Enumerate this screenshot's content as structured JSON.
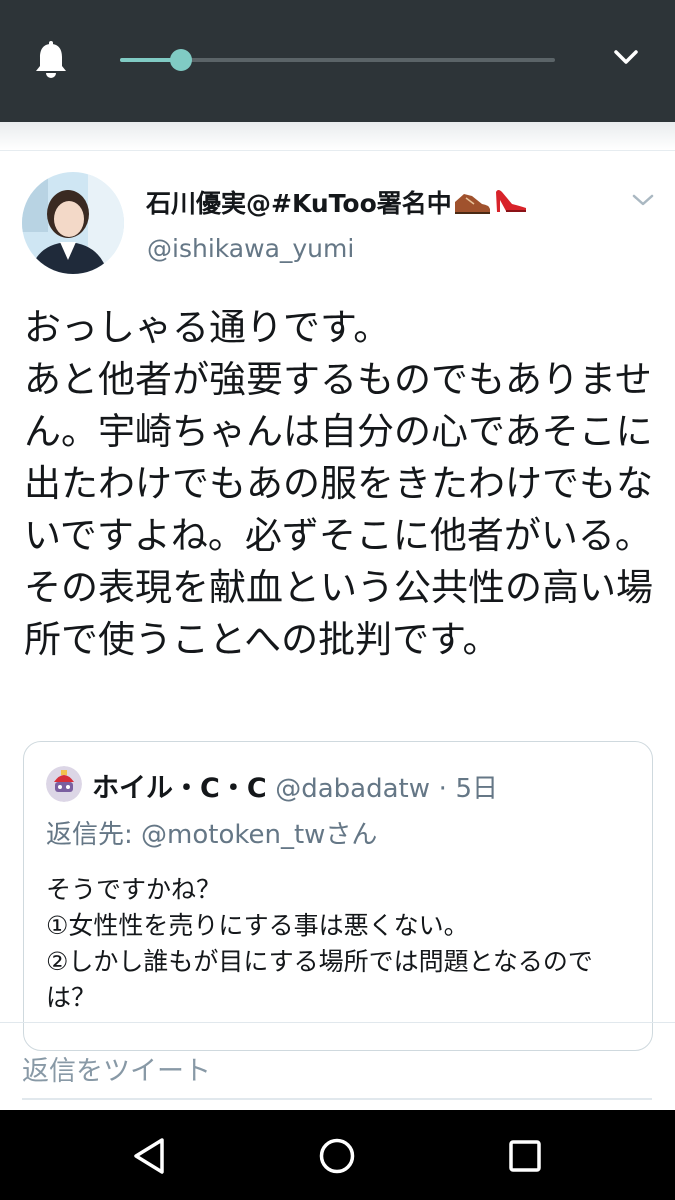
{
  "notification_shade": {
    "brightness_level": 0.14,
    "icons": {
      "bell": "bell-icon",
      "expand": "chevron-down-icon"
    },
    "colors": {
      "background": "#2d3438",
      "accent": "#80cbc4"
    }
  },
  "tweet": {
    "display_name": "石川優実@#KuToo署名中",
    "name_emojis": [
      "man's-shoe-emoji",
      "high-heel-emoji"
    ],
    "handle": "@ishikawa_yumi",
    "text": "おっしゃる通りです。\nあと他者が強要するものでもありません。宇崎ちゃんは自分の心であそこに出たわけでもあの服をきたわけでもないですよね。必ずそこに他者がいる。その表現を献血という公共性の高い場所で使うことへの批判です。",
    "menu_icon": "chevron-down-icon"
  },
  "quoted_tweet": {
    "display_name": "ホイル・C・C",
    "handle": "@dabadatw",
    "separator": "·",
    "time": "5日",
    "reply_to": "返信先: @motoken_twさん",
    "text": "そうですかね？\n①女性性を売りにする事は悪くない。\n②しかし誰もが目にする場所では問題となるのでは？"
  },
  "reply": {
    "placeholder": "返信をツイート"
  },
  "navbar": {
    "icons": [
      "back-triangle-icon",
      "home-circle-icon",
      "recents-square-icon"
    ]
  },
  "colors": {
    "text_primary": "#14171a",
    "text_secondary": "#657786",
    "border": "#cfd9de"
  }
}
